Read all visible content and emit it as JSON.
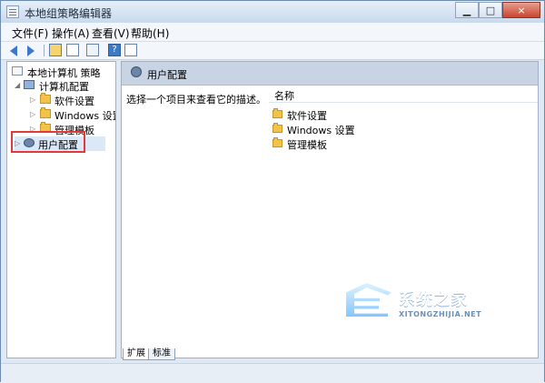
{
  "window": {
    "title": "本地组策略编辑器",
    "min_icon": "minimize-icon",
    "max_icon": "maximize-icon",
    "close_icon": "close-icon"
  },
  "menubar": {
    "items": [
      "文件(F)",
      "操作(A)",
      "查看(V)",
      "帮助(H)"
    ]
  },
  "toolbar": {
    "icons": [
      "back-arrow-icon",
      "forward-arrow-icon",
      "up-folder-icon",
      "show-hide-tree-icon",
      "export-list-icon",
      "help-icon",
      "properties-icon"
    ]
  },
  "tree": {
    "root": "本地计算机 策略",
    "computer_config": "计算机配置",
    "software_settings": "软件设置",
    "windows_settings": "Windows 设置",
    "admin_templates": "管理模板",
    "user_config": "用户配置"
  },
  "details": {
    "header": "用户配置",
    "description": "选择一个项目来查看它的描述。",
    "column": "名称",
    "rows": [
      "软件设置",
      "Windows 设置",
      "管理模板"
    ]
  },
  "tabs": [
    "扩展",
    "标准"
  ],
  "watermark": {
    "cn": "系统之家",
    "en": "XITONGZHIJIA.NET"
  },
  "colors": {
    "accent": "#3d78c6",
    "highlight": "#e2393a",
    "folder": "#f2c34a"
  }
}
